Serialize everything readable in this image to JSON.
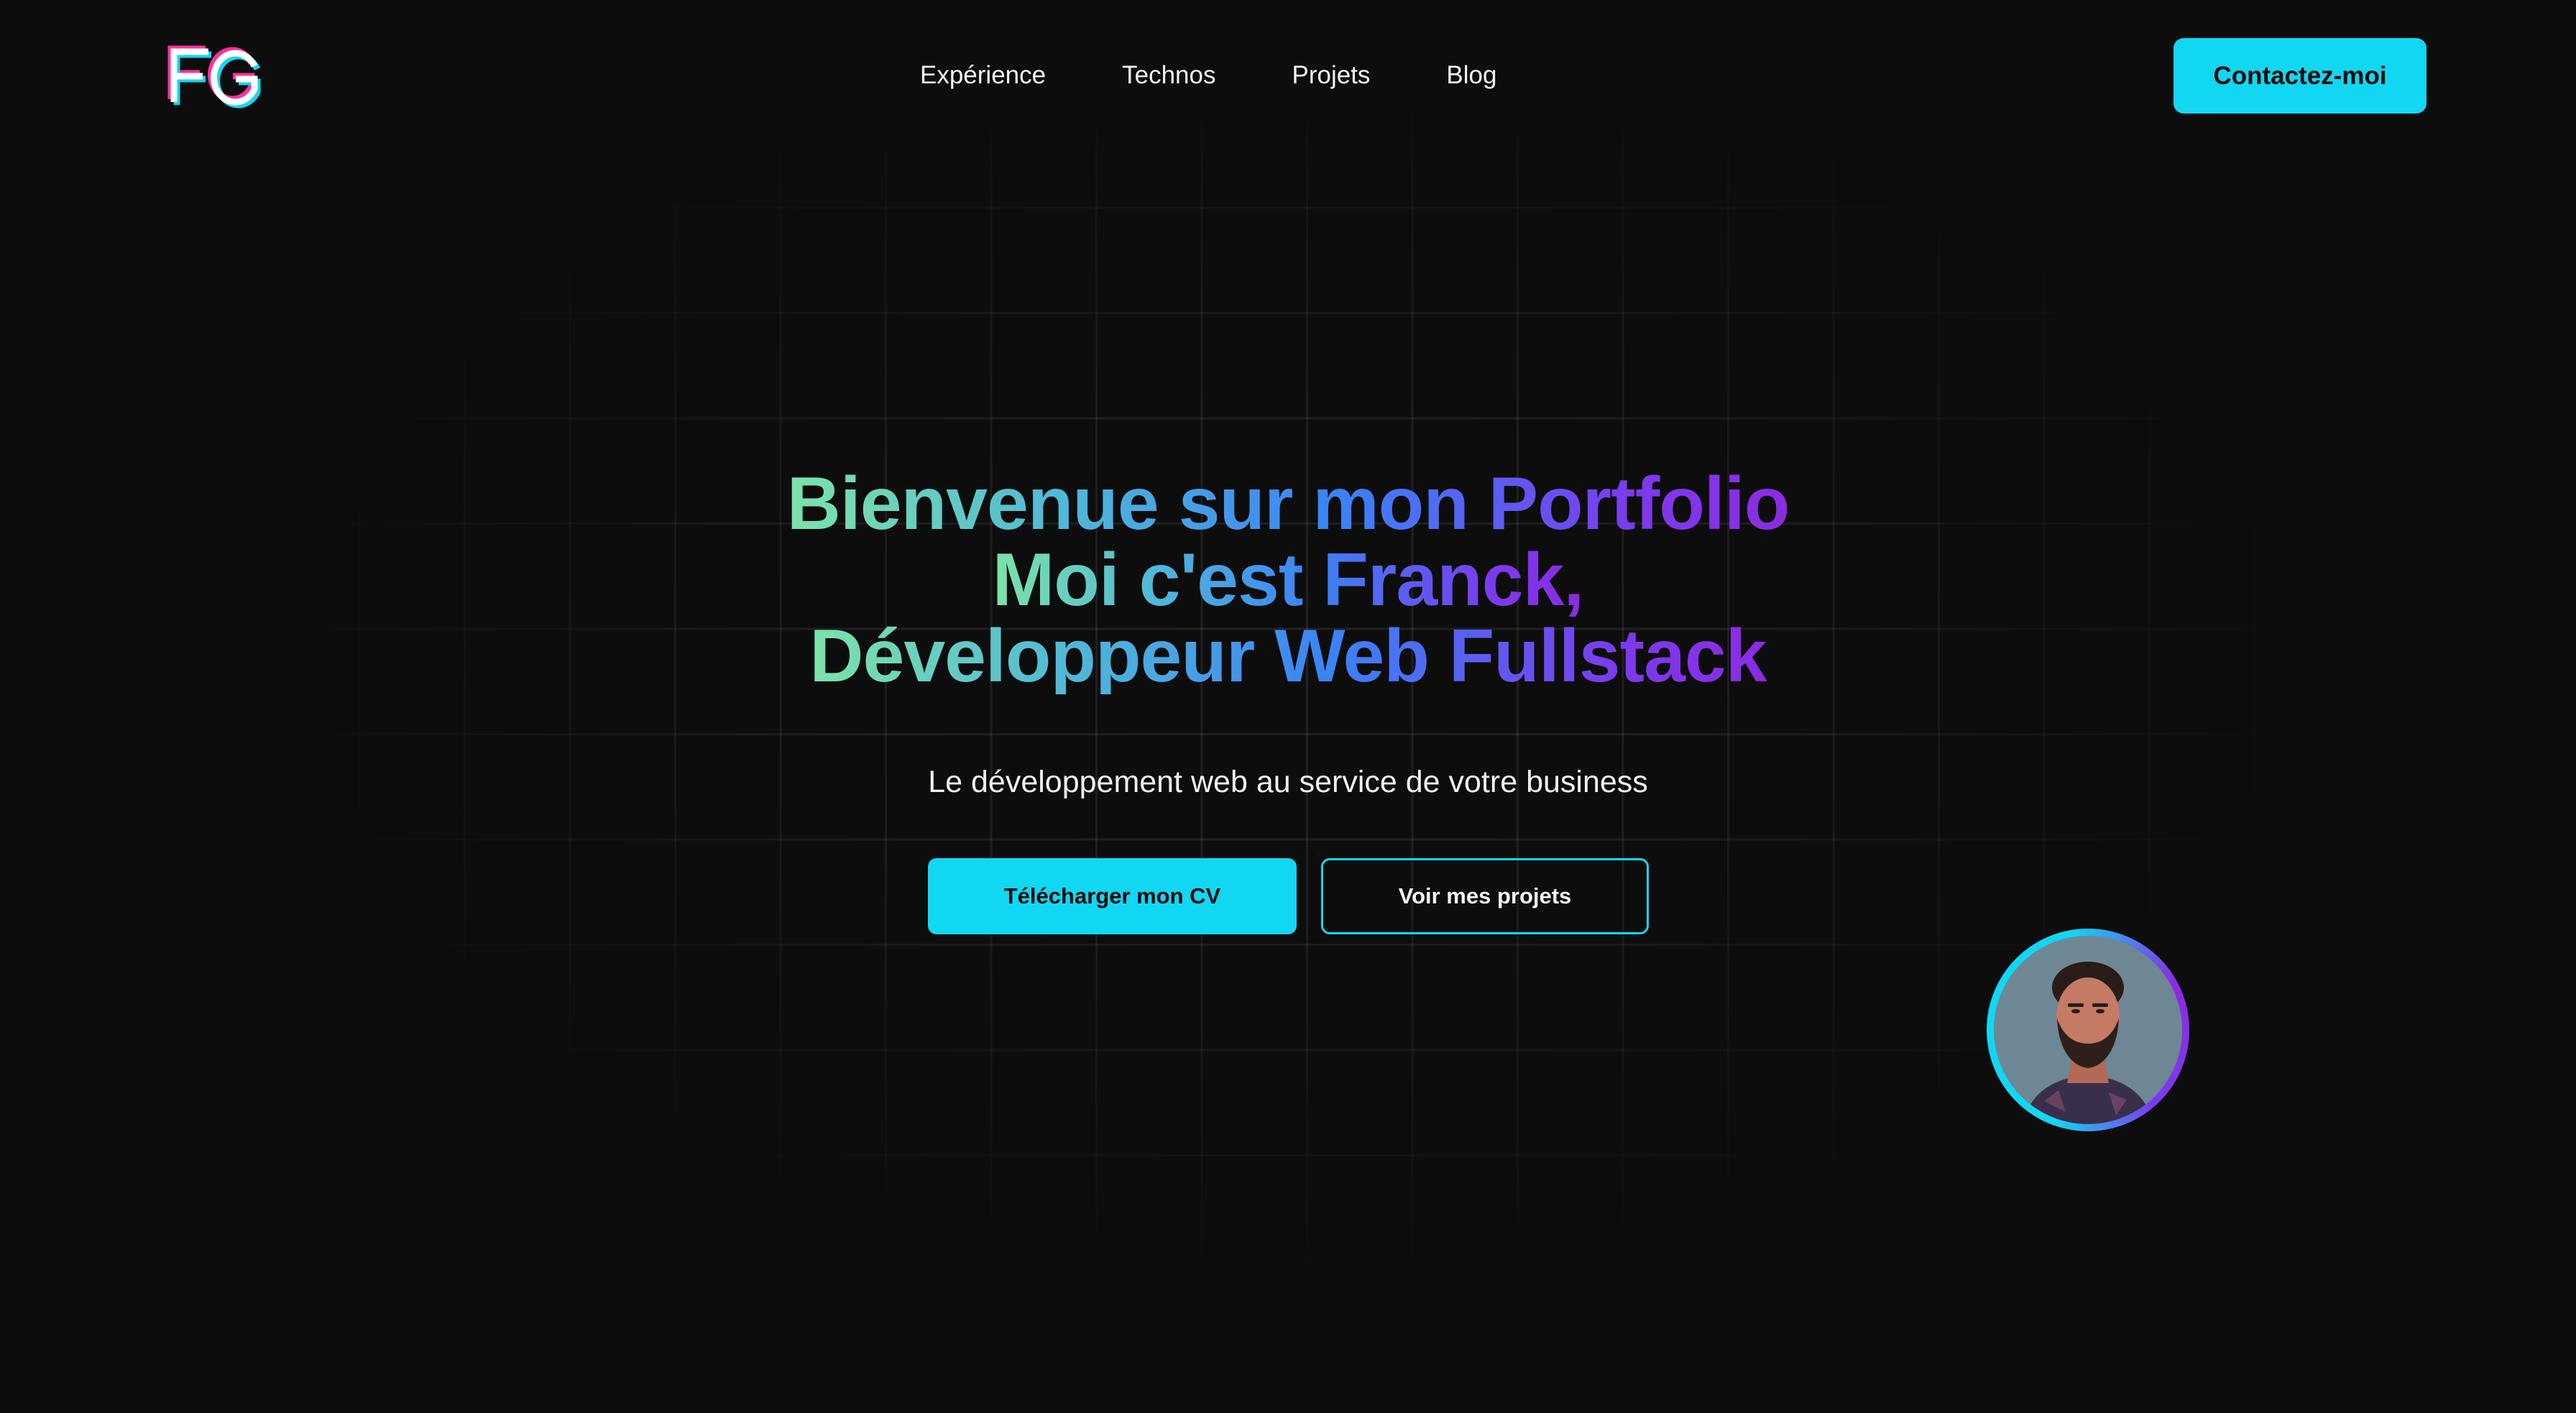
{
  "logo": {
    "text": "FG",
    "colors": {
      "main": "#ffffff",
      "shadow_pink": "#ff2fa0",
      "shadow_cyan": "#12d7f2"
    }
  },
  "nav": {
    "items": [
      {
        "label": "Expérience"
      },
      {
        "label": "Technos"
      },
      {
        "label": "Projets"
      },
      {
        "label": "Blog"
      }
    ]
  },
  "header": {
    "contact_label": "Contactez-moi"
  },
  "hero": {
    "title_lines": [
      "Bienvenue sur mon Portfolio",
      "Moi c'est Franck,",
      "Développeur Web Fullstack"
    ],
    "subtitle": "Le développement web au service de votre business",
    "primary_cta": "Télécharger mon CV",
    "secondary_cta": "Voir mes projets"
  },
  "avatar": {
    "icon": "profile-photo"
  },
  "colors": {
    "background": "#0d0d0d",
    "accent": "#12d7f2",
    "gradient_start": "#7ce3a9",
    "gradient_mid": "#3b82f6",
    "gradient_end": "#8b2be2",
    "text": "#f2f2f2"
  }
}
